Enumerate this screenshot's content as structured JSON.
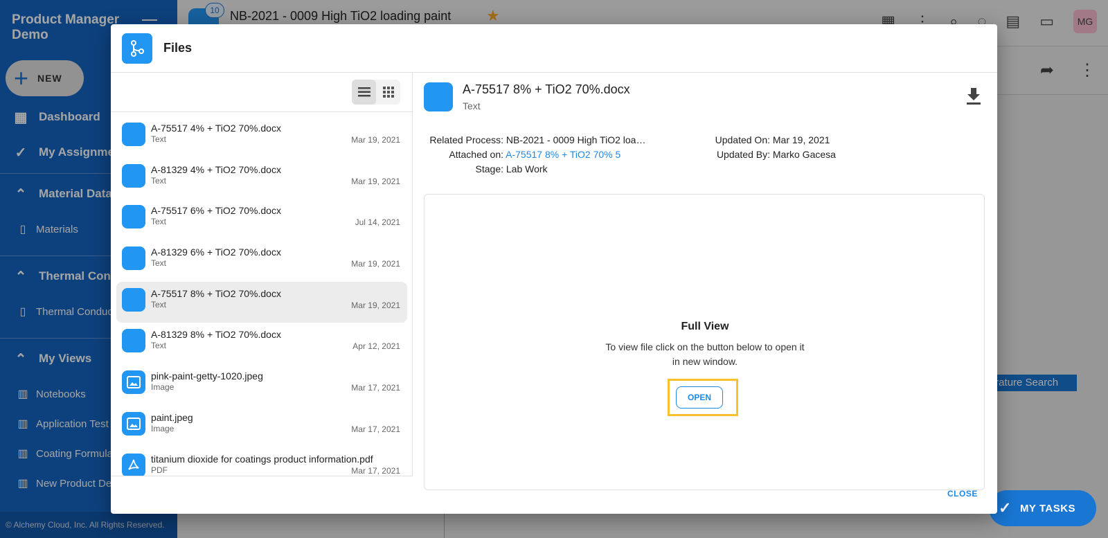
{
  "sidebar": {
    "app_title": "Product Manager Demo",
    "new_label": "NEW",
    "items": [
      {
        "label": "Dashboard",
        "icon": "dashboard-icon"
      },
      {
        "label": "My Assignments",
        "icon": "check-circle-icon"
      }
    ],
    "sections": [
      {
        "label": "Material Data",
        "items": [
          "Materials"
        ]
      },
      {
        "label": "Thermal Conductivity",
        "items": [
          "Thermal Conductivity"
        ]
      },
      {
        "label": "My Views",
        "items": [
          "Notebooks",
          "Application Test",
          "Coating Formulation",
          "New Product Dev"
        ]
      }
    ],
    "footer": "© Alchemy Cloud, Inc. All Rights Reserved."
  },
  "topbar": {
    "badge": "10",
    "title": "NB-2021 - 0009 High TiO2 loading paint",
    "avatar": "MG"
  },
  "background": {
    "literature_search": "Literature Search",
    "my_tasks": "MY TASKS"
  },
  "dialog": {
    "title": "Files",
    "files": [
      {
        "name": "A-75517 4% + TiO2 70%.docx",
        "type": "Text",
        "date": "Mar 19, 2021",
        "icon": "doc-icon"
      },
      {
        "name": "A-81329 4% + TiO2 70%.docx",
        "type": "Text",
        "date": "Mar 19, 2021",
        "icon": "doc-icon"
      },
      {
        "name": "A-75517 6% + TiO2 70%.docx",
        "type": "Text",
        "date": "Jul 14, 2021",
        "icon": "doc-icon"
      },
      {
        "name": "A-81329 6% + TiO2 70%.docx",
        "type": "Text",
        "date": "Mar 19, 2021",
        "icon": "doc-icon"
      },
      {
        "name": "A-75517 8% + TiO2 70%.docx",
        "type": "Text",
        "date": "Mar 19, 2021",
        "icon": "doc-icon",
        "selected": true
      },
      {
        "name": "A-81329 8% + TiO2 70%.docx",
        "type": "Text",
        "date": "Apr 12, 2021",
        "icon": "doc-icon"
      },
      {
        "name": "pink-paint-getty-1020.jpeg",
        "type": "Image",
        "date": "Mar 17, 2021",
        "icon": "image-icon"
      },
      {
        "name": "paint.jpeg",
        "type": "Image",
        "date": "Mar 17, 2021",
        "icon": "image-icon"
      },
      {
        "name": "titanium dioxide for coatings product information.pdf",
        "type": "PDF",
        "date": "Mar 17, 2021",
        "icon": "pdf-icon"
      }
    ],
    "detail": {
      "title": "A-75517 8% + TiO2 70%.docx",
      "type": "Text",
      "related_process_label": "Related Process:",
      "related_process": "NB-2021 - 0009 High TiO2 loa…",
      "attached_on_label": "Attached on:",
      "attached_on": "A-75517 8% + TiO2 70% 5",
      "stage_label": "Stage:",
      "stage": "Lab Work",
      "updated_on_label": "Updated On:",
      "updated_on": "Mar 19, 2021",
      "updated_by_label": "Updated By:",
      "updated_by": "Marko Gacesa"
    },
    "preview": {
      "title": "Full View",
      "text": "To view file click on the button below to open it in new window.",
      "open_label": "OPEN"
    },
    "close_label": "CLOSE"
  }
}
